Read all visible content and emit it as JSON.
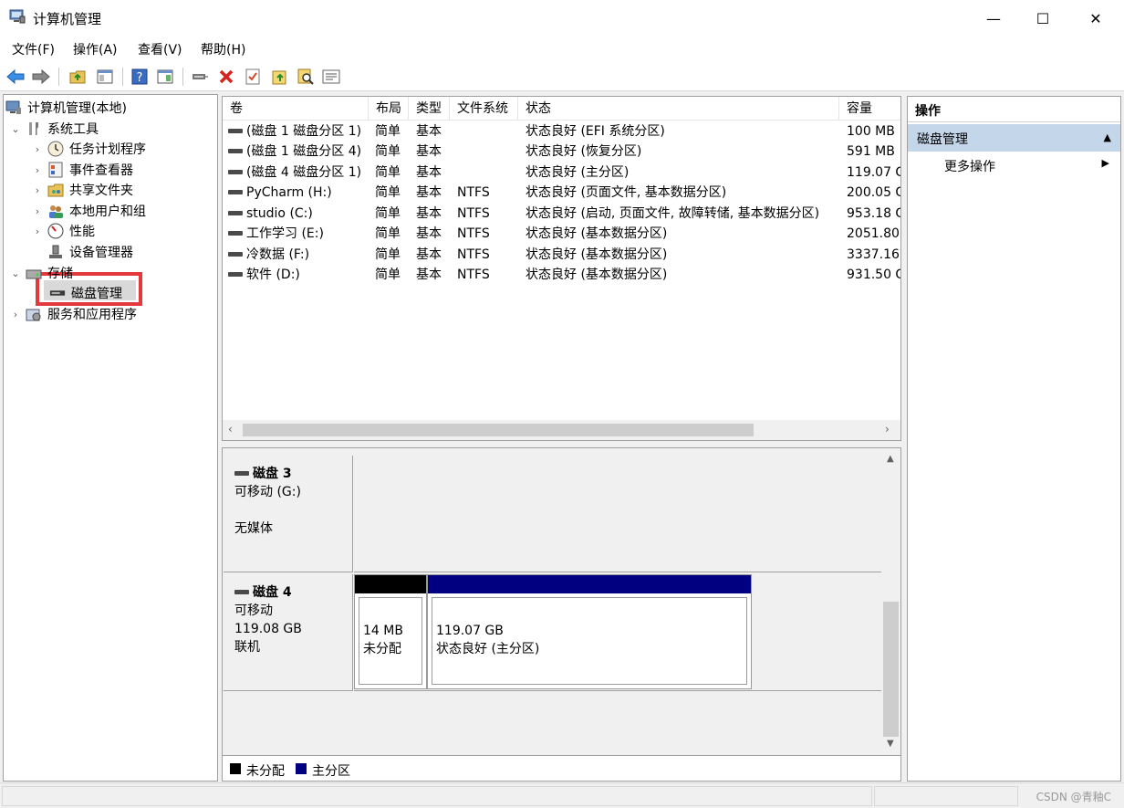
{
  "window": {
    "title": "计算机管理",
    "min_glyph": "—",
    "max_glyph": "☐",
    "close_glyph": "✕"
  },
  "menu": [
    "文件(F)",
    "操作(A)",
    "查看(V)",
    "帮助(H)"
  ],
  "toolbar": {
    "icons": [
      "back-icon",
      "forward-icon",
      "up-folder-icon",
      "show-hide-tree-icon",
      "help-icon",
      "show-hide-action-icon",
      "connect-icon",
      "delete-icon",
      "check-icon",
      "folder-up-icon",
      "search-icon",
      "properties-icon"
    ]
  },
  "tree": {
    "root": "计算机管理(本地)",
    "system_tools": "系统工具",
    "task_scheduler": "任务计划程序",
    "event_viewer": "事件查看器",
    "shared_folders": "共享文件夹",
    "local_users": "本地用户和组",
    "performance": "性能",
    "device_manager": "设备管理器",
    "storage": "存储",
    "disk_management": "磁盘管理",
    "services_apps": "服务和应用程序"
  },
  "volumes": {
    "columns": [
      "卷",
      "布局",
      "类型",
      "文件系统",
      "状态",
      "容量"
    ],
    "rows": [
      {
        "name": "(磁盘 1 磁盘分区 1)",
        "layout": "简单",
        "type": "基本",
        "fs": "",
        "status": "状态良好 (EFI 系统分区)",
        "capacity": "100 MB"
      },
      {
        "name": "(磁盘 1 磁盘分区 4)",
        "layout": "简单",
        "type": "基本",
        "fs": "",
        "status": "状态良好 (恢复分区)",
        "capacity": "591 MB"
      },
      {
        "name": "(磁盘 4 磁盘分区 1)",
        "layout": "简单",
        "type": "基本",
        "fs": "",
        "status": "状态良好 (主分区)",
        "capacity": "119.07 G"
      },
      {
        "name": "PyCharm (H:)",
        "layout": "简单",
        "type": "基本",
        "fs": "NTFS",
        "status": "状态良好 (页面文件, 基本数据分区)",
        "capacity": "200.05 G"
      },
      {
        "name": "studio (C:)",
        "layout": "简单",
        "type": "基本",
        "fs": "NTFS",
        "status": "状态良好 (启动, 页面文件, 故障转储, 基本数据分区)",
        "capacity": "953.18 G"
      },
      {
        "name": "工作学习 (E:)",
        "layout": "简单",
        "type": "基本",
        "fs": "NTFS",
        "status": "状态良好 (基本数据分区)",
        "capacity": "2051.80"
      },
      {
        "name": "冷数据 (F:)",
        "layout": "简单",
        "type": "基本",
        "fs": "NTFS",
        "status": "状态良好 (基本数据分区)",
        "capacity": "3337.16"
      },
      {
        "name": "软件 (D:)",
        "layout": "简单",
        "type": "基本",
        "fs": "NTFS",
        "status": "状态良好 (基本数据分区)",
        "capacity": "931.50 G"
      }
    ]
  },
  "disks": [
    {
      "name": "磁盘 3",
      "line1": "可移动 (G:)",
      "line2": "",
      "line3": "无媒体"
    },
    {
      "name": "磁盘 4",
      "line1": "可移动",
      "line2": "119.08 GB",
      "line3": "联机",
      "partitions": [
        {
          "size": "14 MB",
          "status": "未分配",
          "color": "#000000"
        },
        {
          "size": "119.07 GB",
          "status": "状态良好 (主分区)",
          "color": "#000080"
        }
      ]
    }
  ],
  "legend": [
    {
      "label": "未分配",
      "color": "#000000"
    },
    {
      "label": "主分区",
      "color": "#000080"
    }
  ],
  "actions": {
    "header": "操作",
    "section": "磁盘管理",
    "more": "更多操作"
  },
  "watermark": "CSDN @青釉C",
  "colors": {
    "selection_highlight": "#e4393c",
    "action_section_bg": "#c4d6ea"
  }
}
